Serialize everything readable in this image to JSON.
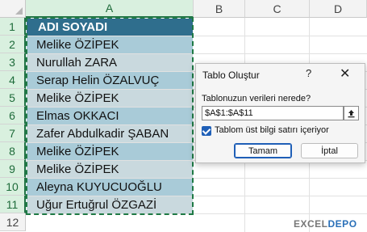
{
  "columns": [
    "A",
    "B",
    "C",
    "D"
  ],
  "rows": [
    "1",
    "2",
    "3",
    "4",
    "5",
    "6",
    "7",
    "8",
    "9",
    "10",
    "11",
    "12"
  ],
  "header_cell": "ADI SOYADI",
  "names": [
    "Melike ÖZİPEK",
    "Nurullah ZARA",
    "Serap Helin ÖZALVUÇ",
    "Melike ÖZİPEK",
    "Elmas OKKACI",
    "Zafer Abdulkadir ŞABAN",
    "Melike ÖZİPEK",
    "Melike ÖZİPEK",
    "Aleyna KUYUCUOĞLU",
    "Uğur Ertuğrul ÖZGAZİ"
  ],
  "dialog": {
    "title": "Tablo Oluştur",
    "help": "?",
    "close": "✕",
    "range_label": "Tablonuzun verileri nerede?",
    "range_value": "$A$1:$A$11",
    "checkbox_label": "Tablom üst bilgi satırı içeriyor",
    "ok_label": "Tamam",
    "cancel_label": "İptal"
  },
  "logo": {
    "part1": "EXCEL",
    "part2": "DEPO"
  },
  "colors": {
    "header": "#2f6e8d",
    "band1": "#a9cbd8",
    "band2": "#c9d9de",
    "accent": "#217346"
  }
}
